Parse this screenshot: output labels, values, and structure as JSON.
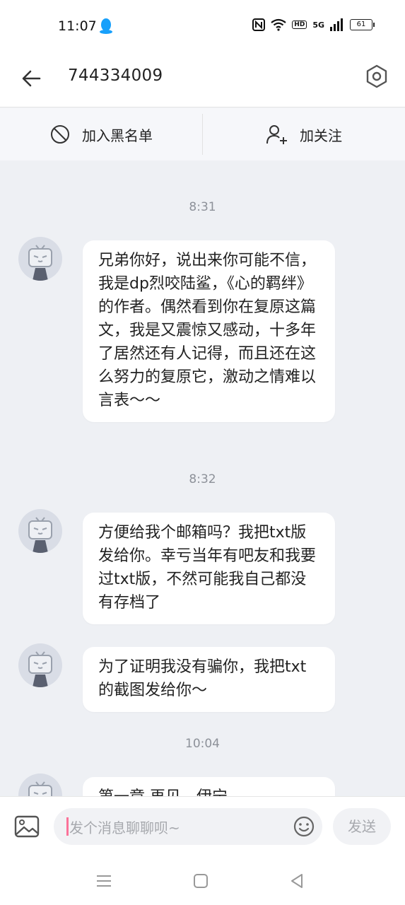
{
  "status_bar": {
    "time": "11:07",
    "network_badge": "HD",
    "network_type": "5G",
    "battery": "61",
    "icons": [
      "qq-penguin-icon",
      "nfc-icon",
      "wifi-icon",
      "hd-icon",
      "5g-icon",
      "signal-icon",
      "battery-icon"
    ]
  },
  "header": {
    "title": "744334009",
    "back_icon": "arrow-left-icon",
    "settings_icon": "hexagon-gear-icon"
  },
  "actions": {
    "block_label": "加入黑名单",
    "follow_label": "加关注"
  },
  "messages": [
    {
      "timestamp": "8:31",
      "text": "兄弟你好，说出来你可能不信，我是dp烈咬陆鲨，《心的羁绊》的作者。偶然看到你在复原这篇文，我是又震惊又感动，十多年了居然还有人记得，而且还在这么努力的复原它，激动之情难以言表～～"
    },
    {
      "timestamp": "8:32",
      "text": "方便给我个邮箱吗？我把txt版发给你。幸亏当年有吧友和我要过txt版，不然可能我自己都没有存档了"
    },
    {
      "text": "为了证明我没有骗你，我把txt的截图发给你～"
    },
    {
      "timestamp": "10:04",
      "text": "第一章  再见，伊宁"
    }
  ],
  "input": {
    "placeholder": "发个消息聊聊呗~",
    "send_label": "发送"
  },
  "colors": {
    "accent_pink": "#fb7299",
    "chat_background": "#eef0f4",
    "bubble": "#ffffff",
    "timestamp_text": "#8d9199"
  }
}
